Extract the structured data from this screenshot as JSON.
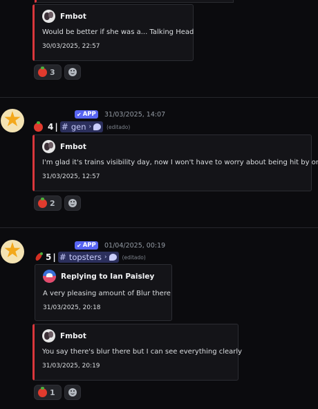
{
  "messages": [
    {
      "embed": {
        "author": "Fmbot",
        "text": "Would be better if she was a... Talking Head",
        "time": "30/03/2025, 22:57"
      },
      "reactions": {
        "count": "3"
      }
    },
    {
      "app_badge": "APP",
      "timestamp": "31/03/2025, 14:07",
      "score": "4",
      "separator": "|",
      "channel": "gen",
      "edited": "(editado)",
      "embed": {
        "author": "Fmbot",
        "text": "I'm glad it's trains visibility day, now I won't have to worry about being hit by one",
        "time": "31/03/2025, 12:57"
      },
      "reactions": {
        "count": "2"
      }
    },
    {
      "app_badge": "APP",
      "timestamp": "01/04/2025, 00:19",
      "score": "5",
      "separator": "|",
      "channel": "topsters",
      "edited": "(editado)",
      "reply_embed": {
        "author": "Replying to Ian Paisley",
        "text": "A very pleasing amount of Blur there",
        "time": "31/03/2025, 20:18"
      },
      "embed": {
        "author": "Fmbot",
        "text": "You say there's blur there but I can see everything clearly",
        "time": "31/03/2025, 20:19"
      },
      "reactions": {
        "count": "1"
      }
    }
  ],
  "icons": {
    "reaction": "tomato-icon",
    "add": "add-reaction-icon",
    "avatar": "star-icon",
    "chili": "chili-pepper-icon"
  },
  "colors": {
    "accent_red": "#da373c",
    "app_badge": "#5865f2",
    "background": "#0b0b0e"
  }
}
